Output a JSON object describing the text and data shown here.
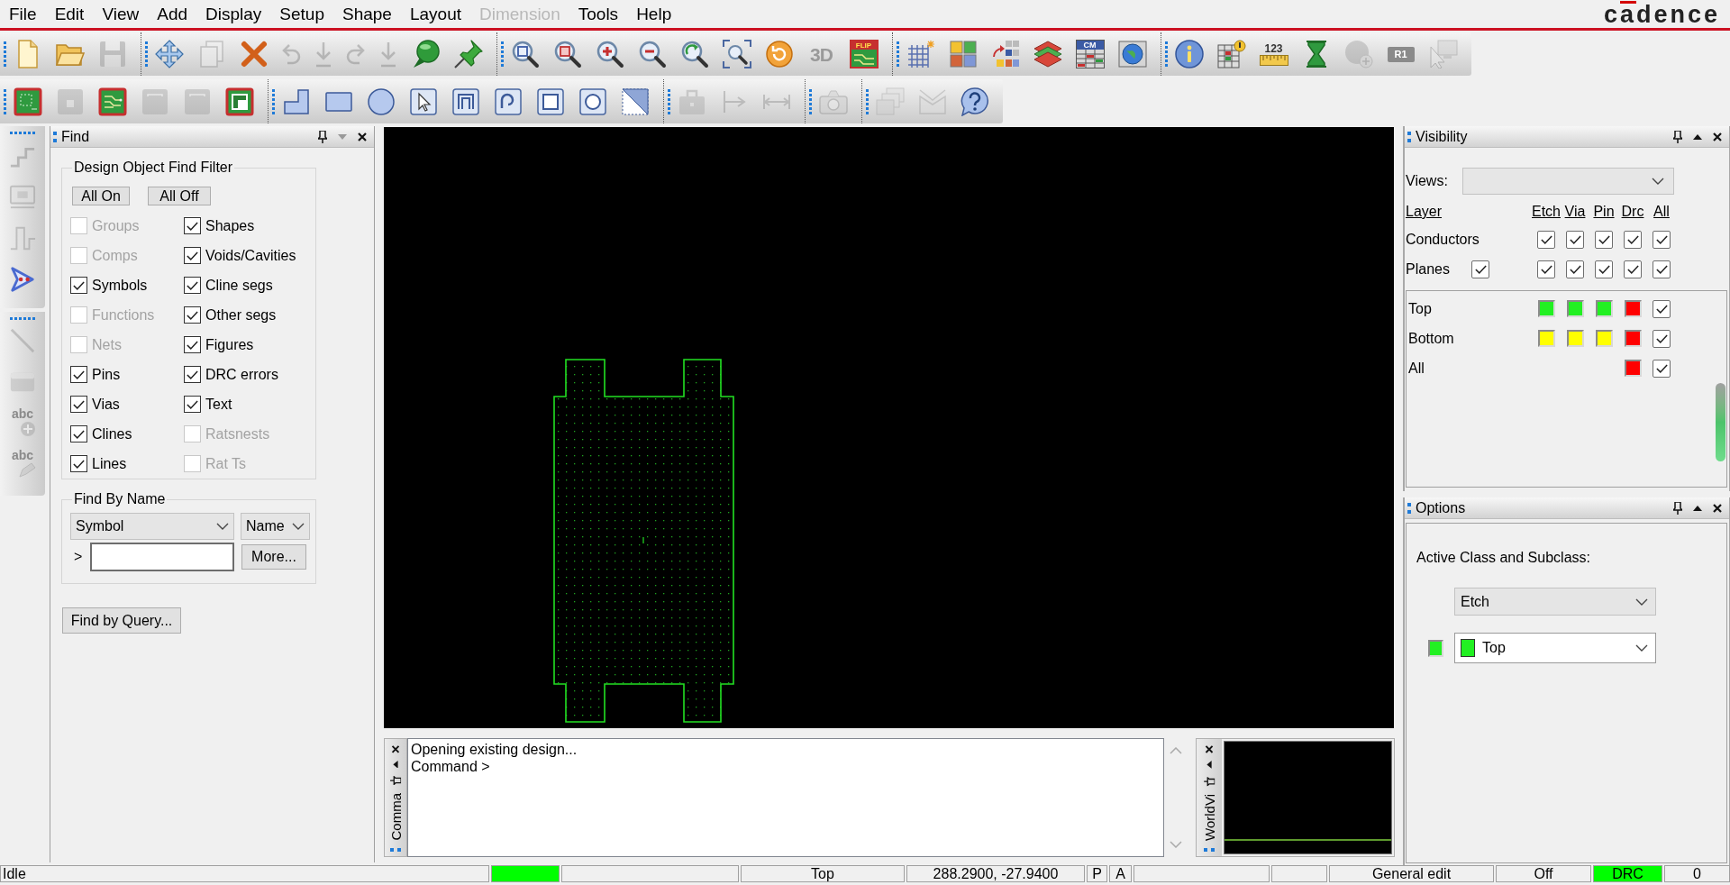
{
  "menu": [
    {
      "label": "File",
      "disabled": false
    },
    {
      "label": "Edit",
      "disabled": false
    },
    {
      "label": "View",
      "disabled": false
    },
    {
      "label": "Add",
      "disabled": false
    },
    {
      "label": "Display",
      "disabled": false
    },
    {
      "label": "Setup",
      "disabled": false
    },
    {
      "label": "Shape",
      "disabled": false
    },
    {
      "label": "Layout",
      "disabled": false
    },
    {
      "label": "Dimension",
      "disabled": true
    },
    {
      "label": "Tools",
      "disabled": false
    },
    {
      "label": "Help",
      "disabled": false
    }
  ],
  "logo": "cadence",
  "toolbars": [
    [
      [
        {
          "kind": "new",
          "disabled": false
        },
        {
          "kind": "open",
          "disabled": false
        },
        {
          "kind": "save",
          "disabled": true
        }
      ],
      [
        {
          "kind": "move",
          "disabled": false
        },
        {
          "kind": "copy",
          "disabled": true
        },
        {
          "kind": "delete",
          "disabled": false
        },
        {
          "kind": "undo",
          "disabled": true
        },
        {
          "kind": "down",
          "disabled": true
        },
        {
          "kind": "redo",
          "disabled": true
        },
        {
          "kind": "down",
          "disabled": true
        },
        {
          "kind": "comment",
          "disabled": false
        },
        {
          "kind": "pin",
          "disabled": false
        }
      ],
      [
        {
          "kind": "zoompoints",
          "disabled": false
        },
        {
          "kind": "zoomfit",
          "disabled": false
        },
        {
          "kind": "zoomin",
          "disabled": false
        },
        {
          "kind": "zoomout",
          "disabled": false
        },
        {
          "kind": "zoomprev",
          "disabled": false
        },
        {
          "kind": "zoomworld",
          "disabled": false
        },
        {
          "kind": "redraw",
          "disabled": false
        },
        {
          "kind": "view3d",
          "text": "3D",
          "disabled": true
        },
        {
          "kind": "flip",
          "text": "FLIP",
          "disabled": false
        }
      ],
      [
        {
          "kind": "grid",
          "disabled": false
        },
        {
          "kind": "tiles",
          "disabled": false
        },
        {
          "kind": "tilearrow",
          "disabled": false
        },
        {
          "kind": "layers",
          "disabled": false
        },
        {
          "kind": "table",
          "text": "CM",
          "disabled": false
        },
        {
          "kind": "globe",
          "disabled": false
        }
      ],
      [
        {
          "kind": "info",
          "disabled": false
        },
        {
          "kind": "tableinfo",
          "disabled": false
        },
        {
          "kind": "ruler",
          "text": "123",
          "disabled": false
        },
        {
          "kind": "hourglass",
          "disabled": false
        },
        {
          "kind": "circleplus",
          "disabled": true
        },
        {
          "kind": "tag",
          "text": "R1",
          "disabled": true
        },
        {
          "kind": "monitor",
          "disabled": true
        }
      ]
    ],
    [
      [
        {
          "kind": "boardoutline",
          "disabled": false
        },
        {
          "kind": "boardslot",
          "disabled": true
        },
        {
          "kind": "boardtraces",
          "disabled": false
        },
        {
          "kind": "frame",
          "disabled": true
        },
        {
          "kind": "frame",
          "disabled": true
        },
        {
          "kind": "boardnotch",
          "disabled": false
        }
      ],
      [
        {
          "kind": "lshape",
          "disabled": false
        },
        {
          "kind": "rect",
          "disabled": false
        },
        {
          "kind": "circle",
          "disabled": false
        },
        {
          "kind": "select",
          "disabled": false
        },
        {
          "kind": "nested",
          "disabled": false
        },
        {
          "kind": "rounded",
          "disabled": false
        },
        {
          "kind": "square",
          "disabled": false
        },
        {
          "kind": "ringsquare",
          "disabled": false
        },
        {
          "kind": "cutsquare",
          "disabled": false
        }
      ],
      [
        {
          "kind": "case",
          "disabled": true
        },
        {
          "kind": "dimension",
          "disabled": true
        },
        {
          "kind": "hdimension",
          "disabled": true
        }
      ],
      [
        {
          "kind": "camera",
          "disabled": true
        }
      ],
      [
        {
          "kind": "windows",
          "disabled": true
        },
        {
          "kind": "envelope",
          "disabled": true
        },
        {
          "kind": "help",
          "disabled": false
        }
      ]
    ]
  ],
  "side_toolbar": [
    [
      {
        "kind": "steps",
        "disabled": true
      },
      {
        "kind": "boardframe",
        "disabled": true
      },
      {
        "kind": "signal",
        "disabled": true
      },
      {
        "kind": "chevron",
        "disabled": false
      }
    ],
    [
      {
        "kind": "line",
        "disabled": true
      },
      {
        "kind": "block",
        "disabled": true
      },
      {
        "kind": "textadd",
        "text": "abc",
        "disabled": true
      },
      {
        "kind": "textedit",
        "text": "abc",
        "disabled": true
      }
    ]
  ],
  "find_panel": {
    "title": "Find",
    "filter": {
      "title": "Design Object Find Filter",
      "buttons": [
        "All On",
        "All Off"
      ],
      "items": [
        {
          "label": "Groups",
          "checked": false,
          "disabled": true
        },
        {
          "label": "Shapes",
          "checked": true,
          "disabled": false
        },
        {
          "label": "Comps",
          "checked": false,
          "disabled": true
        },
        {
          "label": "Voids/Cavities",
          "checked": true,
          "disabled": false
        },
        {
          "label": "Symbols",
          "checked": true,
          "disabled": false
        },
        {
          "label": "Cline segs",
          "checked": true,
          "disabled": false
        },
        {
          "label": "Functions",
          "checked": false,
          "disabled": true
        },
        {
          "label": "Other segs",
          "checked": true,
          "disabled": false
        },
        {
          "label": "Nets",
          "checked": false,
          "disabled": true
        },
        {
          "label": "Figures",
          "checked": true,
          "disabled": false
        },
        {
          "label": "Pins",
          "checked": true,
          "disabled": false
        },
        {
          "label": "DRC errors",
          "checked": true,
          "disabled": false
        },
        {
          "label": "Vias",
          "checked": true,
          "disabled": false
        },
        {
          "label": "Text",
          "checked": true,
          "disabled": false
        },
        {
          "label": "Clines",
          "checked": true,
          "disabled": false
        },
        {
          "label": "Ratsnests",
          "checked": false,
          "disabled": true
        },
        {
          "label": "Lines",
          "checked": true,
          "disabled": false
        },
        {
          "label": "Rat Ts",
          "checked": false,
          "disabled": true
        }
      ]
    },
    "by_name": {
      "title": "Find By Name",
      "object_type": "Symbol",
      "match_by": "Name",
      "prompt": ">",
      "more_button": "More..."
    },
    "query_button": "Find by Query..."
  },
  "command_window": {
    "tab_label": "Comma",
    "lines": [
      "Opening existing design...",
      "Command >"
    ]
  },
  "world_view": {
    "tab_label": "WorldVi"
  },
  "visibility": {
    "title": "Visibility",
    "views_label": "Views:",
    "columns": [
      "Layer",
      "Etch",
      "Via",
      "Pin",
      "Drc",
      "All"
    ],
    "class_rows": [
      {
        "label": "Conductors",
        "toggles": [
          {
            "checked": true
          },
          {
            "checked": true
          },
          {
            "checked": true
          },
          {
            "checked": true
          },
          {
            "checked": true
          }
        ]
      },
      {
        "label": "Planes",
        "plane_toggle": {
          "checked": true
        },
        "toggles": [
          {
            "checked": true
          },
          {
            "checked": true
          },
          {
            "checked": true
          },
          {
            "checked": true
          },
          {
            "checked": true
          }
        ]
      }
    ],
    "layer_rows": [
      {
        "label": "Top",
        "cells": [
          {
            "kind": "swatch",
            "color": "#22f022"
          },
          {
            "kind": "swatch",
            "color": "#22f022"
          },
          {
            "kind": "swatch",
            "color": "#22f022"
          },
          {
            "kind": "swatch",
            "color": "#ff0000"
          },
          {
            "kind": "check",
            "checked": true
          }
        ]
      },
      {
        "label": "Bottom",
        "cells": [
          {
            "kind": "swatch",
            "color": "#ffff00"
          },
          {
            "kind": "swatch",
            "color": "#ffff00"
          },
          {
            "kind": "swatch",
            "color": "#ffff00"
          },
          {
            "kind": "swatch",
            "color": "#ff0000"
          },
          {
            "kind": "check",
            "checked": true
          }
        ]
      },
      {
        "label": "All",
        "cells": [
          {
            "kind": "swatch",
            "color": "#ff0000"
          },
          {
            "kind": "check",
            "checked": true
          }
        ]
      }
    ]
  },
  "options": {
    "title": "Options",
    "label": "Active Class and Subclass:",
    "class_value": "Etch",
    "subclass": {
      "color": "#22f022",
      "value": "Top"
    }
  },
  "status_bar": [
    {
      "kind": "text",
      "text": "Idle"
    },
    {
      "kind": "indicator",
      "color": "#00ff00"
    },
    {
      "kind": "blank"
    },
    {
      "kind": "text",
      "text": "Top"
    },
    {
      "kind": "text",
      "text": "288.2900, -27.9400"
    },
    {
      "kind": "text",
      "text": "P"
    },
    {
      "kind": "text",
      "text": "A"
    },
    {
      "kind": "blank"
    },
    {
      "kind": "blank"
    },
    {
      "kind": "text",
      "text": "General edit"
    },
    {
      "kind": "text",
      "text": "Off"
    },
    {
      "kind": "indicator",
      "color": "#00ff00",
      "text": "DRC"
    },
    {
      "kind": "text",
      "text": "0"
    }
  ]
}
